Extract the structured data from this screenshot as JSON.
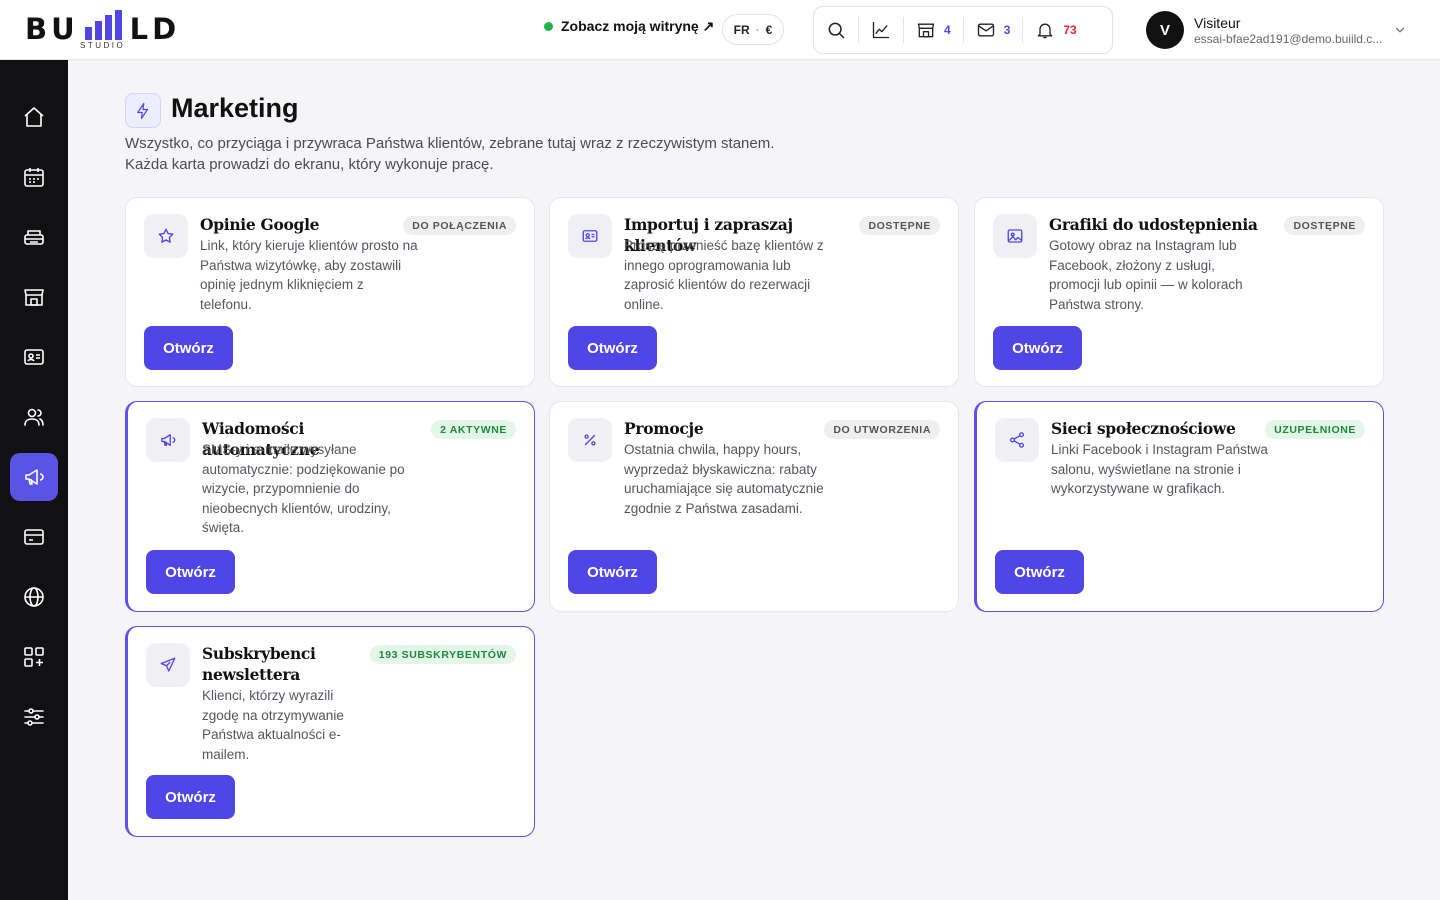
{
  "header": {
    "logo": {
      "text_left": "BU",
      "text_right": "LD",
      "sub": "STUDIO"
    },
    "site_link": "Zobacz moją witrynę ↗",
    "lang": "FR",
    "currency": "€",
    "toolbar": {
      "shops_count": "4",
      "messages_count": "3",
      "notifications_count": "73"
    },
    "user": {
      "initial": "V",
      "name": "Visiteur",
      "email": "essai-bfae2ad191@demo.buiild.c..."
    }
  },
  "sidebar": {
    "items": [
      {
        "name": "home",
        "icon": "home-icon"
      },
      {
        "name": "calendar",
        "icon": "calendar-icon"
      },
      {
        "name": "services",
        "icon": "tray-icon"
      },
      {
        "name": "store",
        "icon": "store-icon"
      },
      {
        "name": "contacts",
        "icon": "id-card-icon"
      },
      {
        "name": "clients",
        "icon": "users-icon"
      },
      {
        "name": "marketing",
        "icon": "megaphone-icon",
        "active": true
      },
      {
        "name": "payments",
        "icon": "credit-card-icon"
      },
      {
        "name": "website",
        "icon": "globe-icon"
      },
      {
        "name": "apps",
        "icon": "grid-plus-icon"
      },
      {
        "name": "settings",
        "icon": "sliders-icon"
      }
    ]
  },
  "page": {
    "title": "Marketing",
    "desc_line1": "Wszystko, co przyciąga i przywraca Państwa klientów, zebrane tutaj wraz z rzeczywistym stanem.",
    "desc_line2": "Każda karta prowadzi do ekranu, który wykonuje pracę."
  },
  "cards": [
    {
      "title": "Opinie Google",
      "badge": "DO POŁĄCZENIA",
      "badge_color": "#efefef",
      "icon": "star-icon",
      "desc": "Link, który kieruje klientów prosto na Państwa wizytówkę, aby zostawili opinię jednym kliknięciem z telefonu.",
      "button": "Otwórz"
    },
    {
      "title": "Importuj i zapraszaj klientów",
      "badge": "DOSTĘPNE",
      "badge_color": "#efefef",
      "icon": "id-card-icon",
      "desc": "Proszę przenieść bazę klientów z innego oprogramowania lub zaprosić klientów do rezerwacji online.",
      "button": "Otwórz"
    },
    {
      "title": "Grafiki do udostępnienia",
      "badge": "DOSTĘPNE",
      "badge_color": "#efefef",
      "icon": "image-icon",
      "desc": "Gotowy obraz na Instagram lub Facebook, złożony z usługi, promocji lub opinii — w kolorach Państwa strony.",
      "button": "Otwórz"
    },
    {
      "title": "Wiadomości automatyczne",
      "badge": "2 AKTYWNE",
      "badge_color": "#e4f6e8",
      "icon": "megaphone-icon",
      "desc": "SMS-y i e-maile wysyłane automatycznie: podziękowanie po wizycie, przypomnienie do nieobecnych klientów, urodziny, święta.",
      "button": "Otwórz"
    },
    {
      "title": "Promocje",
      "badge": "DO UTWORZENIA",
      "badge_color": "#efefef",
      "icon": "percent-icon",
      "desc": "Ostatnia chwila, happy hours, wyprzedaż błyskawiczna: rabaty uruchamiające się automatycznie zgodnie z Państwa zasadami.",
      "button": "Otwórz"
    },
    {
      "title": "Sieci społecznościowe",
      "badge": "UZUPEŁNIONE",
      "badge_color": "#e4f6e8",
      "icon": "share-icon",
      "desc": "Linki Facebook i Instagram Państwa salonu, wyświetlane na stronie i wykorzystywane w grafikach.",
      "button": "Otwórz"
    },
    {
      "title": "Subskrybenci newslettera",
      "badge": "193 SUBSKRYBENTÓW",
      "badge_color": "#e4f6e8",
      "icon": "send-icon",
      "desc": "Klienci, którzy wyrazili zgodę na otrzymywanie Państwa aktualności e-mailem.",
      "button": "Otwórz"
    }
  ],
  "colors": {
    "accent": "#5046e5",
    "sidebar": "#111114",
    "notification": "#e0243a",
    "status_dot": "#22b34a"
  }
}
